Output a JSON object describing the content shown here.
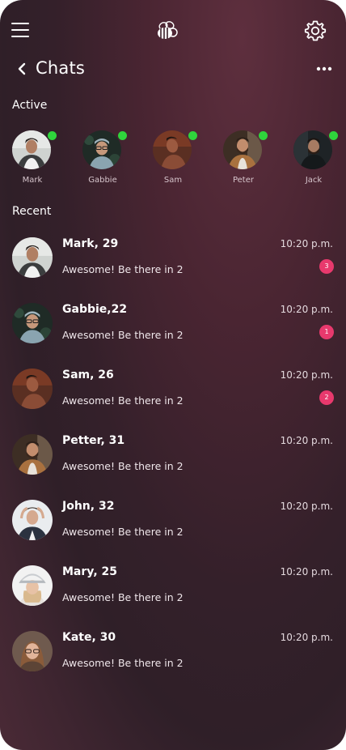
{
  "header": {
    "menu_icon": "hamburger-menu-icon",
    "logo_icon": "bee-logo-icon",
    "settings_icon": "gear-icon",
    "back_icon": "chevron-left-icon",
    "title": "Chats",
    "more_icon": "more-horizontal-icon"
  },
  "sections": {
    "active_label": "Active",
    "recent_label": "Recent"
  },
  "colors": {
    "online": "#2fd43c",
    "badge": "#e8396d"
  },
  "active": [
    {
      "name": "Mark"
    },
    {
      "name": "Gabbie"
    },
    {
      "name": "Sam"
    },
    {
      "name": "Peter"
    },
    {
      "name": "Jack"
    }
  ],
  "chats": [
    {
      "name": "Mark, 29",
      "message": "Awesome! Be there in 2",
      "time": "10:20 p.m.",
      "unread": "3"
    },
    {
      "name": "Gabbie,22",
      "message": "Awesome! Be there in 2",
      "time": "10:20 p.m.",
      "unread": "1"
    },
    {
      "name": "Sam, 26",
      "message": "Awesome! Be there in 2",
      "time": "10:20 p.m.",
      "unread": "2"
    },
    {
      "name": "Petter, 31",
      "message": "Awesome! Be there in 2",
      "time": "10:20 p.m.",
      "unread": ""
    },
    {
      "name": "John, 32",
      "message": "Awesome! Be there in 2",
      "time": "10:20 p.m.",
      "unread": ""
    },
    {
      "name": "Mary, 25",
      "message": "Awesome! Be there in 2",
      "time": "10:20 p.m.",
      "unread": ""
    },
    {
      "name": "Kate, 30",
      "message": "Awesome! Be there in 2",
      "time": "10:20 p.m.",
      "unread": ""
    }
  ]
}
